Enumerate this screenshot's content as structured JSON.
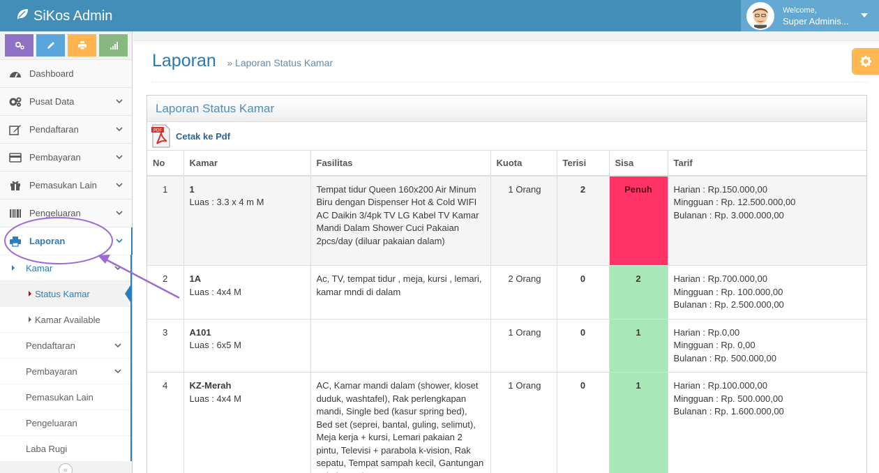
{
  "navbar": {
    "brand": "SiKos Admin",
    "welcome": "Welcome,",
    "user_name": "Super Adminis..."
  },
  "shortcuts": [
    {
      "name": "settings",
      "color": "#8f71c5"
    },
    {
      "name": "edit",
      "color": "#5aa6dc"
    },
    {
      "name": "print",
      "color": "#ffb44f"
    },
    {
      "name": "signal",
      "color": "#87b87f"
    }
  ],
  "sidebar": {
    "items": [
      {
        "label": "Dashboard"
      },
      {
        "label": "Pusat Data"
      },
      {
        "label": "Pendaftaran"
      },
      {
        "label": "Pembayaran"
      },
      {
        "label": "Pemasukan Lain"
      },
      {
        "label": "Pengeluaran"
      },
      {
        "label": "Laporan"
      }
    ],
    "laporan_sub": {
      "kamar": "Kamar",
      "status_kamar": "Status Kamar",
      "kamar_available": "Kamar Available",
      "pendaftaran": "Pendaftaran",
      "pembayaran": "Pembayaran",
      "pemasukan_lain": "Pemasukan Lain",
      "pengeluaran": "Pengeluaran",
      "laba_rugi": "Laba Rugi"
    },
    "collapse": "«"
  },
  "page": {
    "title": "Laporan",
    "breadcrumb": "» Laporan Status Kamar",
    "box_title": "Laporan Status Kamar",
    "pdf_label": "Cetak ke Pdf",
    "pdf_icon_text": "PDF"
  },
  "table": {
    "headers": [
      "No",
      "Kamar",
      "Fasilitas",
      "Kuota",
      "Terisi",
      "Sisa",
      "Tarif"
    ],
    "rows": [
      {
        "no": "1",
        "kamar": "1",
        "luas": "Luas : 3.3 x 4 m M",
        "fasilitas": "Tempat tidur Queen 160x200 Air Minum Biru dengan Dispenser Hot & Cold WIFI AC Daikin 3/4pk TV LG Kabel TV Kamar Mandi Dalam Shower Cuci Pakaian 2pcs/day (diluar pakaian dalam)",
        "kuota": "1 Orang",
        "terisi": "2",
        "sisa": "Penuh",
        "harian": "Harian : Rp.150.000,00",
        "mingguan": "Mingguan : Rp. 12.500.000,00",
        "bulanan": "Bulanan : Rp. 3.000.000,00"
      },
      {
        "no": "2",
        "kamar": "1A",
        "luas": "Luas : 4x4 M",
        "fasilitas": "Ac, TV, tempat tidur , meja, kursi , lemari, kamar mndi di dalam",
        "kuota": "2 Orang",
        "terisi": "0",
        "sisa": "2",
        "harian": "Harian : Rp.700.000,00",
        "mingguan": "Mingguan : Rp. 100.000,00",
        "bulanan": "Bulanan : Rp. 2.500.000,00"
      },
      {
        "no": "3",
        "kamar": "A101",
        "luas": "Luas : 6x5 M",
        "fasilitas": "",
        "kuota": "1 Orang",
        "terisi": "0",
        "sisa": "1",
        "harian": "Harian : Rp.0,00",
        "mingguan": "Mingguan : Rp. 0,00",
        "bulanan": "Bulanan : Rp. 500.000,00"
      },
      {
        "no": "4",
        "kamar": "KZ-Merah",
        "luas": "Luas : 4x4 M",
        "fasilitas": "AC, Kamar mandi dalam (shower, kloset duduk, washtafel), Rak perlengkapan mandi, Single bed (kasur spring bed), Bed set (seprei, bantal, guling, selimut), Meja kerja + kursi, Lemari pakaian 2 pintu, Televisi + parabola k-vision, Rak sepatu, Tempat sampah kecil, Gantungan pakaian, Ada",
        "kuota": "1 Orang",
        "terisi": "0",
        "sisa": "1",
        "harian": "Harian : Rp.100.000,00",
        "mingguan": "Mingguan : Rp. 500.000,00",
        "bulanan": "Bulanan : Rp. 1.600.000,00"
      }
    ]
  },
  "colors": {
    "navbar": "#438eb9",
    "accent": "#2b7dbc",
    "full": "#ff3366",
    "available": "#a8e8b8",
    "annotation": "#9d6bd6"
  }
}
